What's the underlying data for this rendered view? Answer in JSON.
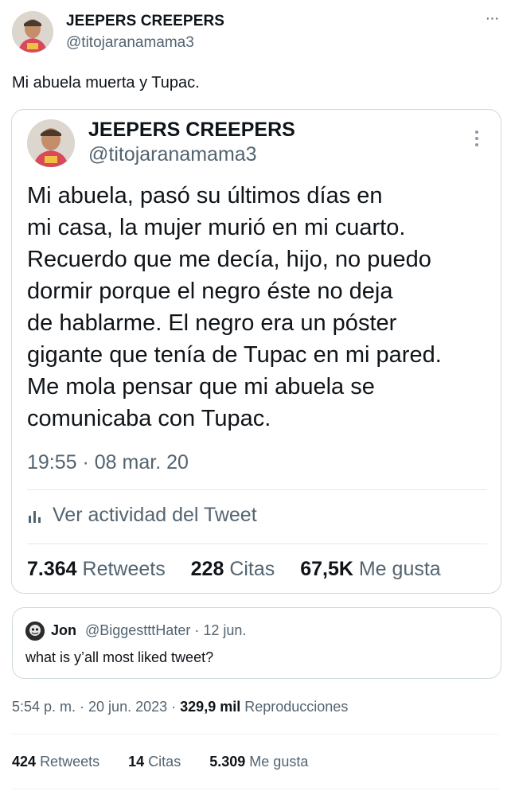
{
  "tweet": {
    "display_name": "JEEPERS CREEPERS",
    "handle": "@titojaranamama3",
    "more_icon": "more-horizontal-icon",
    "text": "Mi abuela muerta y Tupac.",
    "timestamp": "5:54 p. m. · 20 jun. 2023",
    "views_count": "329,9 mil",
    "views_label": "Reproducciones",
    "stats": {
      "retweets_count": "424",
      "retweets_label": "Retweets",
      "quotes_count": "14",
      "quotes_label": "Citas",
      "likes_count": "5.309",
      "likes_label": "Me gusta"
    }
  },
  "embedded_tweet": {
    "display_name": "JEEPERS CREEPERS",
    "handle": "@titojaranamama3",
    "more_icon": "more-vertical-icon",
    "lines": [
      "Mi abuela, pasó su últimos días en",
      "mi casa, la mujer murió en mi cuarto.",
      "Recuerdo que me decía, hijo, no puedo",
      "dormir porque el negro éste no deja",
      "de hablarme. El negro era un póster",
      "gigante que tenía de Tupac en mi pared.",
      "Me mola pensar que mi abuela se",
      "comunicaba con Tupac."
    ],
    "timestamp": "19:55 · 08 mar. 20",
    "activity_label": "Ver actividad del Tweet",
    "activity_icon": "analytics-icon",
    "stats": {
      "retweets_count": "7.364",
      "retweets_label": "Retweets",
      "quotes_count": "228",
      "quotes_label": "Citas",
      "likes_count": "67,5K",
      "likes_label": "Me gusta"
    }
  },
  "quoted_tweet": {
    "display_name": "Jon",
    "handle_and_date": "@BiggestttHater · 12 jun.",
    "text": "what is y’all most liked tweet?"
  },
  "colors": {
    "text_primary": "#0f1419",
    "text_secondary": "#536471",
    "border": "#cfd9de"
  }
}
